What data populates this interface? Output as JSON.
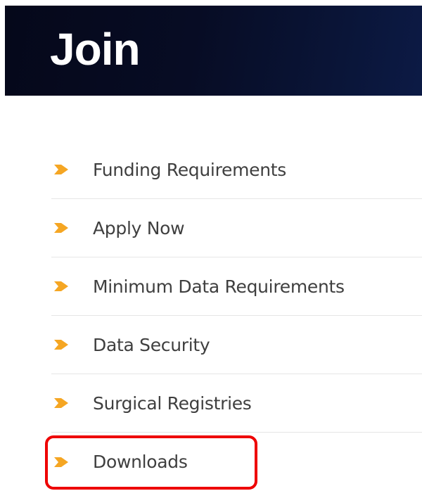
{
  "header": {
    "title": "Join",
    "bg_color": "#070c24"
  },
  "nav": {
    "arrow_color": "#f5a623",
    "items": [
      {
        "label": "Funding Requirements"
      },
      {
        "label": "Apply Now"
      },
      {
        "label": "Minimum Data Requirements"
      },
      {
        "label": "Data Security"
      },
      {
        "label": "Surgical Registries"
      },
      {
        "label": "Downloads",
        "highlighted": true
      }
    ]
  },
  "highlight": {
    "color": "#ee0000",
    "target": "Downloads"
  }
}
